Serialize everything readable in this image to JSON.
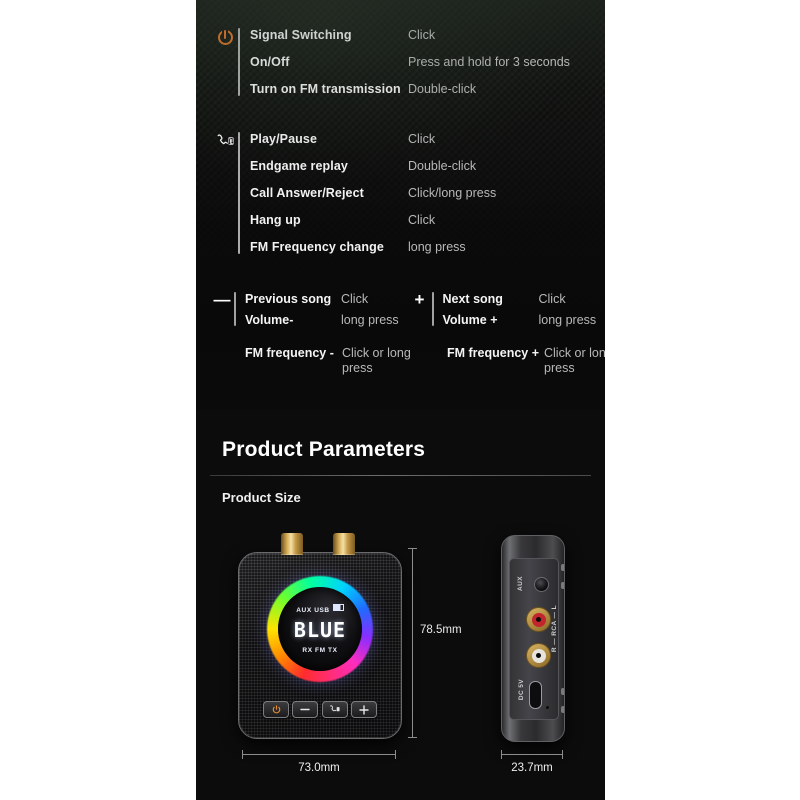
{
  "operations": {
    "groups": [
      {
        "icon": "power-icon",
        "rows": [
          {
            "function": "Signal Switching",
            "action": "Click"
          },
          {
            "function": "On/Off",
            "action": "Press and hold for 3 seconds"
          },
          {
            "function": "Turn on FM transmission",
            "action": "Double-click"
          }
        ]
      },
      {
        "icon": "call-music-icon",
        "rows": [
          {
            "function": "Play/Pause",
            "action": "Click"
          },
          {
            "function": "Endgame replay",
            "action": "Double-click"
          },
          {
            "function": "Call Answer/Reject",
            "action": "Click/long press"
          },
          {
            "function": "Hang up",
            "action": "Click"
          },
          {
            "function": "FM Frequency change",
            "action": "long press"
          }
        ]
      }
    ],
    "minus_column": {
      "symbol": "—",
      "rows": [
        {
          "function": "Previous song",
          "action": "Click"
        },
        {
          "function": "Volume-",
          "action": "long press"
        }
      ],
      "extra": {
        "function": "FM frequency -",
        "action": "Click or long press"
      }
    },
    "plus_column": {
      "symbol": "+",
      "rows": [
        {
          "function": "Next song",
          "action": "Click"
        },
        {
          "function": "Volume +",
          "action": "long press"
        }
      ],
      "extra": {
        "function": "FM frequency +",
        "action": "Click or long press"
      }
    }
  },
  "parameters": {
    "title": "Product Parameters",
    "subtitle": "Product Size",
    "dimensions": {
      "height": "78.5mm",
      "front_width": "73.0mm",
      "side_width": "23.7mm"
    }
  },
  "device": {
    "display": {
      "top_labels": "AUX USB",
      "main": "BLUE",
      "bottom_labels": "RX  FM  TX"
    },
    "buttons": [
      {
        "name": "power",
        "glyph": "⏻"
      },
      {
        "name": "minus",
        "glyph": "—"
      },
      {
        "name": "call",
        "glyph": "☎"
      },
      {
        "name": "plus",
        "glyph": "+"
      }
    ],
    "side_ports": {
      "aux": "AUX",
      "rca": "R — RCA — L",
      "power": "DC 5V"
    }
  },
  "colors": {
    "accent_orange": "#d4722a",
    "background": "#0b0b0b",
    "text_primary": "#f2f2f2",
    "text_secondary": "#b9b9b9"
  }
}
